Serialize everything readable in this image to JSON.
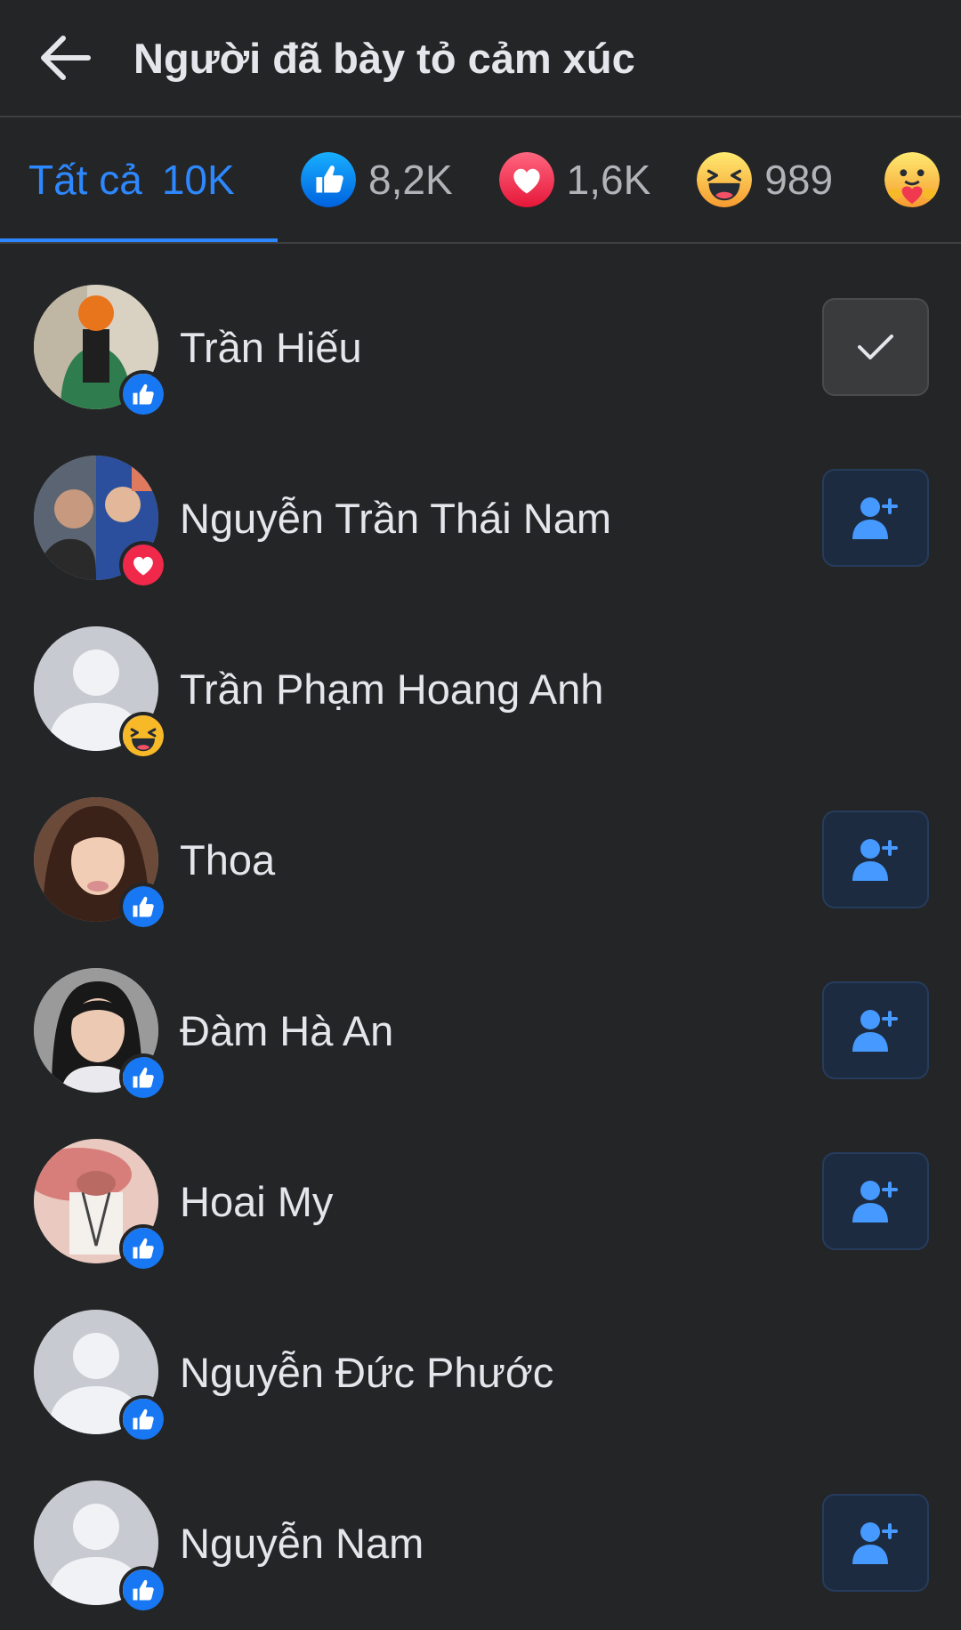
{
  "header": {
    "title": "Người đã bày tỏ cảm xúc",
    "back_icon": "arrow-left-icon"
  },
  "tabs": [
    {
      "label": "Tất cả",
      "count": "10K",
      "active": true
    },
    {
      "reaction": "like",
      "count": "8,2K",
      "icon": "like-reaction-icon"
    },
    {
      "reaction": "love",
      "count": "1,6K",
      "icon": "love-reaction-icon"
    },
    {
      "reaction": "haha",
      "count": "989",
      "icon": "haha-reaction-icon"
    },
    {
      "reaction": "care",
      "count": "",
      "icon": "care-reaction-icon"
    }
  ],
  "people": [
    {
      "name": "Trần Hiếu",
      "reaction": "like",
      "action": "friends"
    },
    {
      "name": "Nguyễn Trần Thái Nam",
      "reaction": "love",
      "action": "add-friend"
    },
    {
      "name": "Trần Phạm Hoang Anh",
      "reaction": "haha",
      "action": "none"
    },
    {
      "name": "Thoa",
      "reaction": "like",
      "action": "add-friend"
    },
    {
      "name": "Đàm Hà An",
      "reaction": "like",
      "action": "add-friend"
    },
    {
      "name": "Hoai My",
      "reaction": "like",
      "action": "add-friend"
    },
    {
      "name": "Nguyễn Đức Phước",
      "reaction": "like",
      "action": "none"
    },
    {
      "name": "Nguyễn Nam",
      "reaction": "like",
      "action": "add-friend"
    }
  ],
  "colors": {
    "background": "#242526",
    "accent": "#2d88ff",
    "like": "#1877f2",
    "love": "#f02849",
    "haha": "#f7b928"
  }
}
